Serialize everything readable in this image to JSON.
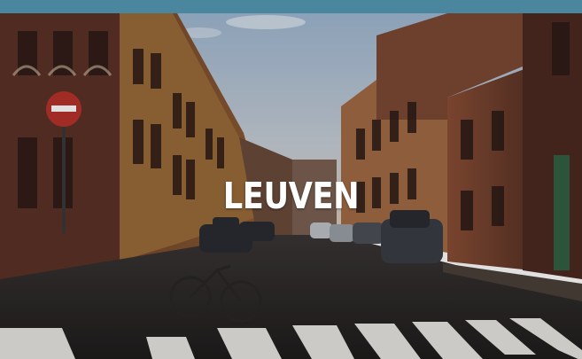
{
  "hero": {
    "title": "LEUVEN"
  },
  "colors": {
    "top_bar": "#4a869e",
    "title": "#ffffff"
  },
  "image": {
    "subject": "street-scene-photo"
  }
}
